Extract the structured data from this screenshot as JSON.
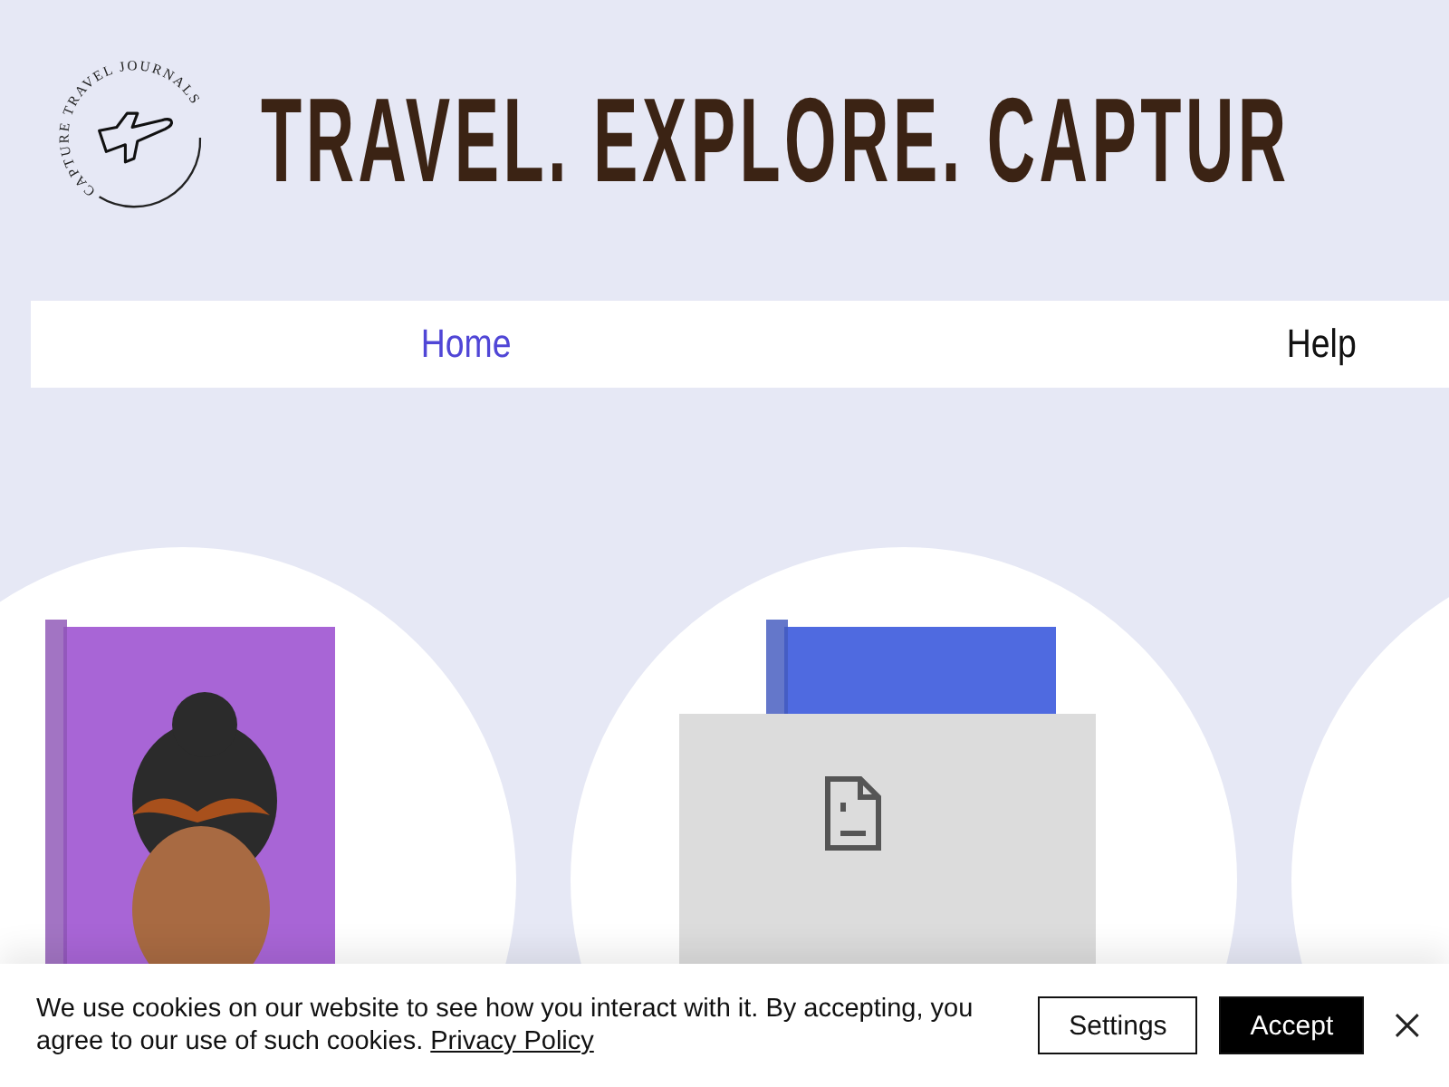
{
  "logo": {
    "text": "CAPTURE TRAVEL JOURNALS"
  },
  "headline": "TRAVEL. EXPLORE. CAPTUR",
  "nav": [
    {
      "label": "Home",
      "selected": true
    },
    {
      "label": "Help",
      "selected": false
    }
  ],
  "products": [
    {
      "kind": "book",
      "color": "#a865d6"
    },
    {
      "kind": "book_broken",
      "color": "#4f6ae0"
    },
    {
      "kind": "empty"
    }
  ],
  "cookie_banner": {
    "text": "We use cookies on our website to see how you interact with it. By accepting, you agree to our use of such cookies.",
    "link": "Privacy Policy",
    "buttons": [
      {
        "label": "Settings",
        "kind": "outline"
      },
      {
        "label": "Accept",
        "kind": "filled"
      }
    ]
  }
}
